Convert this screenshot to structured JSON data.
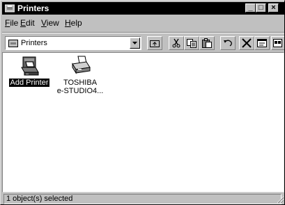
{
  "window": {
    "title": "Printers"
  },
  "caption_buttons": {
    "minimize": "_",
    "maximize": "□",
    "close": "×"
  },
  "menu": [
    {
      "key": "F",
      "rest": "ile"
    },
    {
      "key": "E",
      "rest": "dit"
    },
    {
      "key": "V",
      "rest": "iew"
    },
    {
      "key": "H",
      "rest": "elp"
    }
  ],
  "address": {
    "value": "Printers"
  },
  "toolbar": {
    "buttons": [
      "up-folder-icon",
      "cut-icon",
      "copy-icon",
      "paste-icon",
      "undo-icon",
      "delete-icon",
      "properties-icon",
      "large-icons-view-icon"
    ]
  },
  "items": [
    {
      "label": "Add Printer",
      "selected": true
    },
    {
      "label_line1": "TOSHIBA",
      "label_line2": "e-STUDIO4...",
      "selected": false
    }
  ],
  "status": {
    "text": "1 object(s) selected"
  },
  "colors": {
    "title_bar": "#000000",
    "face": "#c0c0c0",
    "selection": "#000000"
  }
}
